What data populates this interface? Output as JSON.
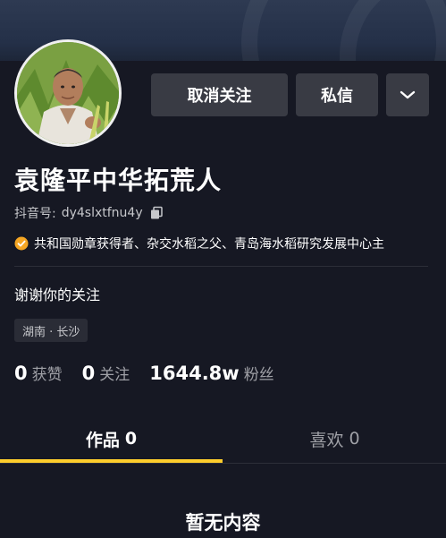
{
  "profile": {
    "name": "袁隆平中华拓荒人",
    "douyin_id_label": "抖音号:",
    "douyin_id": "dy4slxtfnu4y",
    "verification": "共和国勋章获得者、杂交水稻之父、青岛海水稻研究发展中心主",
    "signature": "谢谢你的关注",
    "location_tag": "湖南 · 长沙"
  },
  "actions": {
    "unfollow_label": "取消关注",
    "message_label": "私信"
  },
  "stats": {
    "likes_count": "0",
    "likes_label": "获赞",
    "following_count": "0",
    "following_label": "关注",
    "followers_count": "1644.8w",
    "followers_label": "粉丝"
  },
  "tabs": {
    "works_label": "作品",
    "works_count": "0",
    "likes_label": "喜欢",
    "likes_count": "0",
    "active": "works"
  },
  "empty_state": "暂无内容",
  "icons": {
    "dropdown": "chevron-down-icon",
    "copy": "copy-icon",
    "verified": "verified-badge-icon"
  },
  "colors": {
    "background": "#161823",
    "button": "#393b44",
    "accent": "#fdcd2c",
    "verified": "#f5a623",
    "muted_text": "#9fa0a6"
  }
}
